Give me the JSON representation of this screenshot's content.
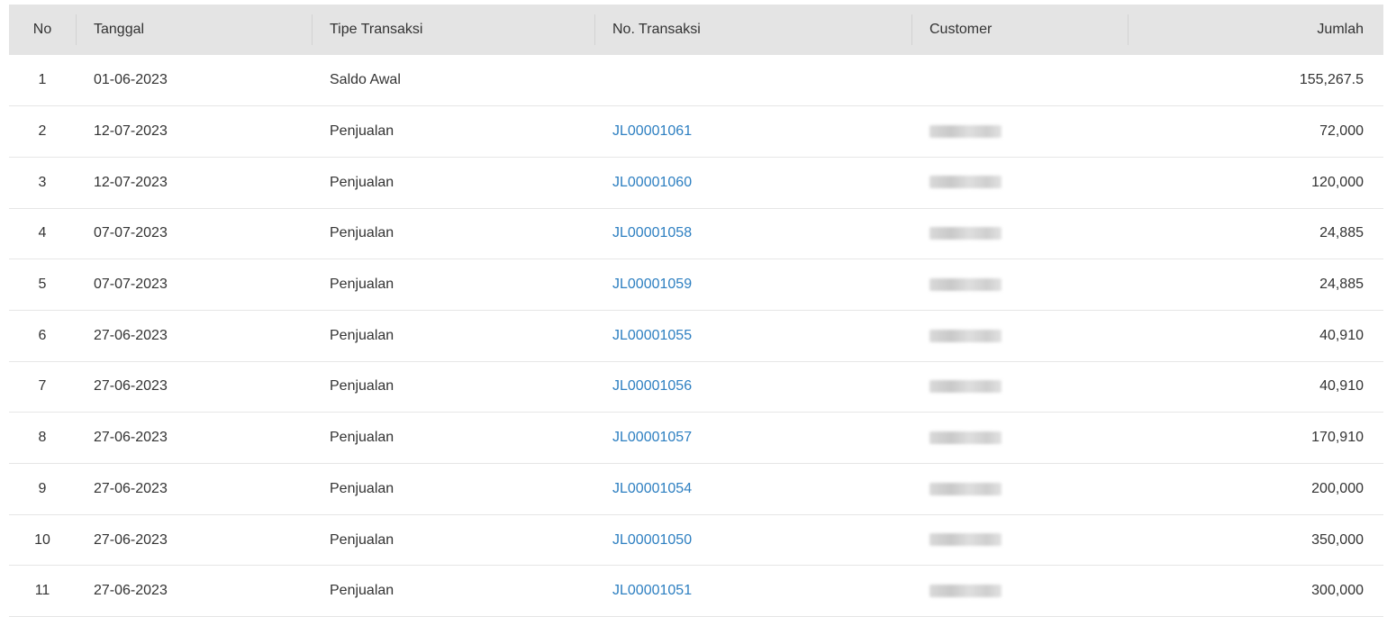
{
  "table": {
    "headers": {
      "no": "No",
      "tanggal": "Tanggal",
      "tipe": "Tipe Transaksi",
      "no_transaksi": "No. Transaksi",
      "customer": "Customer",
      "jumlah": "Jumlah"
    },
    "rows": [
      {
        "no": "1",
        "tanggal": "01-06-2023",
        "tipe": "Saldo Awal",
        "no_transaksi": "",
        "customer_redacted": false,
        "jumlah": "155,267.5"
      },
      {
        "no": "2",
        "tanggal": "12-07-2023",
        "tipe": "Penjualan",
        "no_transaksi": "JL00001061",
        "customer_redacted": true,
        "jumlah": "72,000"
      },
      {
        "no": "3",
        "tanggal": "12-07-2023",
        "tipe": "Penjualan",
        "no_transaksi": "JL00001060",
        "customer_redacted": true,
        "jumlah": "120,000"
      },
      {
        "no": "4",
        "tanggal": "07-07-2023",
        "tipe": "Penjualan",
        "no_transaksi": "JL00001058",
        "customer_redacted": true,
        "jumlah": "24,885"
      },
      {
        "no": "5",
        "tanggal": "07-07-2023",
        "tipe": "Penjualan",
        "no_transaksi": "JL00001059",
        "customer_redacted": true,
        "jumlah": "24,885"
      },
      {
        "no": "6",
        "tanggal": "27-06-2023",
        "tipe": "Penjualan",
        "no_transaksi": "JL00001055",
        "customer_redacted": true,
        "jumlah": "40,910"
      },
      {
        "no": "7",
        "tanggal": "27-06-2023",
        "tipe": "Penjualan",
        "no_transaksi": "JL00001056",
        "customer_redacted": true,
        "jumlah": "40,910"
      },
      {
        "no": "8",
        "tanggal": "27-06-2023",
        "tipe": "Penjualan",
        "no_transaksi": "JL00001057",
        "customer_redacted": true,
        "jumlah": "170,910"
      },
      {
        "no": "9",
        "tanggal": "27-06-2023",
        "tipe": "Penjualan",
        "no_transaksi": "JL00001054",
        "customer_redacted": true,
        "jumlah": "200,000"
      },
      {
        "no": "10",
        "tanggal": "27-06-2023",
        "tipe": "Penjualan",
        "no_transaksi": "JL00001050",
        "customer_redacted": true,
        "jumlah": "350,000"
      },
      {
        "no": "11",
        "tanggal": "27-06-2023",
        "tipe": "Penjualan",
        "no_transaksi": "JL00001051",
        "customer_redacted": true,
        "jumlah": "300,000"
      }
    ]
  },
  "colors": {
    "header_bg": "#e4e4e4",
    "link": "#2d7fc1",
    "text": "#333333",
    "row_border": "#e6e6e6"
  }
}
